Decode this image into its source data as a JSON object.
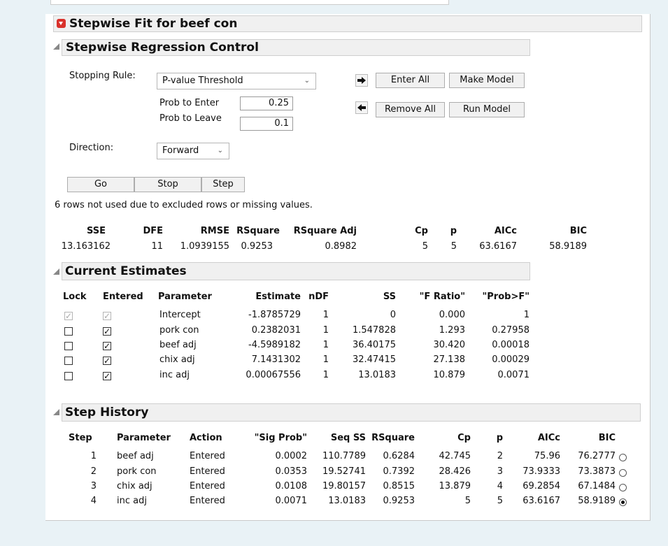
{
  "title": "Stepwise Fit for beef con",
  "control": {
    "title": "Stepwise Regression Control",
    "stopping_rule_label": "Stopping Rule:",
    "stopping_rule_value": "P-value Threshold",
    "prob_enter_label": "Prob to Enter",
    "prob_enter_value": "0.25",
    "prob_leave_label": "Prob to Leave",
    "prob_leave_value": "0.1",
    "direction_label": "Direction:",
    "direction_value": "Forward",
    "enter_all": "Enter All",
    "make_model": "Make Model",
    "remove_all": "Remove All",
    "run_model": "Run Model",
    "go": "Go",
    "stop": "Stop",
    "step": "Step",
    "note": "6 rows not used due to excluded rows or missing values."
  },
  "summary": {
    "headers": [
      "SSE",
      "DFE",
      "RMSE",
      "RSquare",
      "RSquare Adj",
      "Cp",
      "p",
      "AICc",
      "BIC"
    ],
    "values": [
      "13.163162",
      "11",
      "1.0939155",
      "0.9253",
      "0.8982",
      "5",
      "5",
      "63.6167",
      "58.9189"
    ]
  },
  "estimates": {
    "title": "Current Estimates",
    "headers": [
      "Lock",
      "Entered",
      "Parameter",
      "Estimate",
      "nDF",
      "SS",
      "\"F Ratio\"",
      "\"Prob>F\""
    ],
    "rows": [
      {
        "lock": true,
        "entered": true,
        "locked": true,
        "parameter": "Intercept",
        "estimate": "-1.8785729",
        "ndf": "1",
        "ss": "0",
        "f": "0.000",
        "p": "1"
      },
      {
        "lock": false,
        "entered": true,
        "locked": false,
        "parameter": "pork con",
        "estimate": "0.2382031",
        "ndf": "1",
        "ss": "1.547828",
        "f": "1.293",
        "p": "0.27958"
      },
      {
        "lock": false,
        "entered": true,
        "locked": false,
        "parameter": "beef adj",
        "estimate": "-4.5989182",
        "ndf": "1",
        "ss": "36.40175",
        "f": "30.420",
        "p": "0.00018"
      },
      {
        "lock": false,
        "entered": true,
        "locked": false,
        "parameter": "chix adj",
        "estimate": "7.1431302",
        "ndf": "1",
        "ss": "32.47415",
        "f": "27.138",
        "p": "0.00029"
      },
      {
        "lock": false,
        "entered": true,
        "locked": false,
        "parameter": "inc adj",
        "estimate": "0.00067556",
        "ndf": "1",
        "ss": "13.0183",
        "f": "10.879",
        "p": "0.0071"
      }
    ]
  },
  "history": {
    "title": "Step History",
    "headers": [
      "Step",
      "Parameter",
      "Action",
      "\"Sig Prob\"",
      "Seq SS",
      "RSquare",
      "Cp",
      "p",
      "AICc",
      "BIC"
    ],
    "rows": [
      {
        "step": "1",
        "parameter": "beef adj",
        "action": "Entered",
        "sig": "0.0002",
        "seqss": "110.7789",
        "rsq": "0.6284",
        "cp": "42.745",
        "p": "2",
        "aicc": "75.96",
        "bic": "76.2777",
        "selected": false
      },
      {
        "step": "2",
        "parameter": "pork con",
        "action": "Entered",
        "sig": "0.0353",
        "seqss": "19.52741",
        "rsq": "0.7392",
        "cp": "28.426",
        "p": "3",
        "aicc": "73.9333",
        "bic": "73.3873",
        "selected": false
      },
      {
        "step": "3",
        "parameter": "chix adj",
        "action": "Entered",
        "sig": "0.0108",
        "seqss": "19.80157",
        "rsq": "0.8515",
        "cp": "13.879",
        "p": "4",
        "aicc": "69.2854",
        "bic": "67.1484",
        "selected": false
      },
      {
        "step": "4",
        "parameter": "inc adj",
        "action": "Entered",
        "sig": "0.0071",
        "seqss": "13.0183",
        "rsq": "0.9253",
        "cp": "5",
        "p": "5",
        "aicc": "63.6167",
        "bic": "58.9189",
        "selected": true
      }
    ]
  }
}
